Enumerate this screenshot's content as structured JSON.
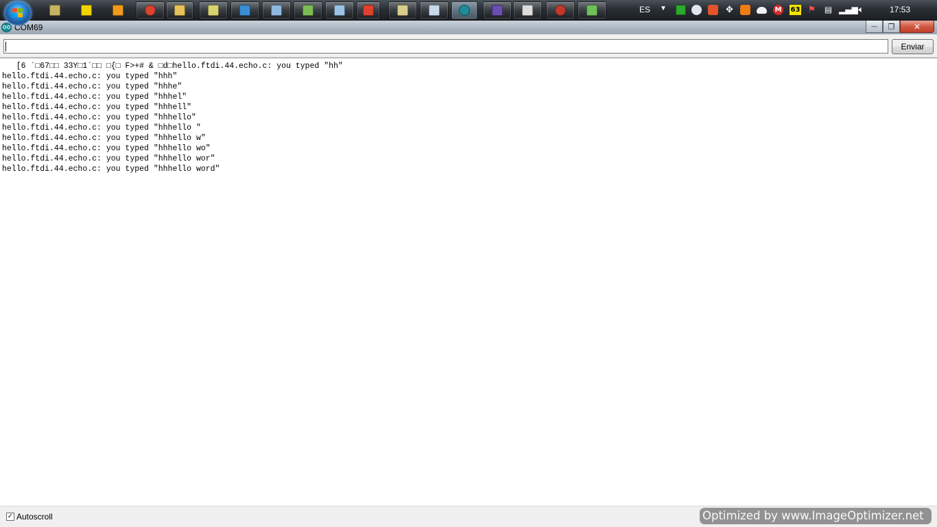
{
  "taskbar": {
    "apps": [
      {
        "name": "media-center-icon",
        "color": "#c8b460"
      },
      {
        "name": "netbeans-like-icon",
        "color": "#f2d200"
      },
      {
        "name": "media-player-icon",
        "color": "#f29a1c"
      },
      {
        "name": "chrome-icon",
        "color": "#d9432f"
      },
      {
        "name": "explorer-folder-icon",
        "color": "#e7c25a"
      },
      {
        "name": "files-icon",
        "color": "#d7d36f"
      },
      {
        "name": "remote-desktop-icon",
        "color": "#3a8fd4"
      },
      {
        "name": "notepad-icon",
        "color": "#8fb9e0"
      },
      {
        "name": "git-icon",
        "color": "#7bbd55"
      },
      {
        "name": "window-icon",
        "color": "#9cc3e6"
      },
      {
        "name": "red-app-icon",
        "color": "#e0412f"
      },
      {
        "name": "editor-icon",
        "color": "#d9cd8a"
      },
      {
        "name": "document-icon",
        "color": "#c9d9ea"
      },
      {
        "name": "arduino-icon",
        "color": "#1c8c96"
      },
      {
        "name": "inkscape-icon",
        "color": "#6a4fb0"
      },
      {
        "name": "inkscape-alt-icon",
        "color": "#dddddd"
      },
      {
        "name": "bug-icon",
        "color": "#c0392b"
      },
      {
        "name": "terminal-icon",
        "color": "#6fbf5a"
      }
    ],
    "language": "ES",
    "badge_count": "63",
    "clock": "17:53"
  },
  "window": {
    "title": "COM69",
    "minimize_glyph": "—",
    "maximize_glyph": "❐",
    "close_glyph": "✕"
  },
  "toolbar": {
    "input_value": "",
    "send_label": "Enviar"
  },
  "serial_output": {
    "lines": [
      "   [6 ´□67□□ 33Y□1´□□ □{□ F>+# & □d□hello.ftdi.44.echo.c: you typed \"hh\"",
      "hello.ftdi.44.echo.c: you typed \"hhh\"",
      "hello.ftdi.44.echo.c: you typed \"hhhe\"",
      "hello.ftdi.44.echo.c: you typed \"hhhel\"",
      "hello.ftdi.44.echo.c: you typed \"hhhell\"",
      "hello.ftdi.44.echo.c: you typed \"hhhello\"",
      "hello.ftdi.44.echo.c: you typed \"hhhello \"",
      "hello.ftdi.44.echo.c: you typed \"hhhello w\"",
      "hello.ftdi.44.echo.c: you typed \"hhhello wo\"",
      "hello.ftdi.44.echo.c: you typed \"hhhello wor\"",
      "hello.ftdi.44.echo.c: you typed \"hhhello word\""
    ]
  },
  "statusbar": {
    "autoscroll_label": "Autoscroll",
    "autoscroll_checked": true,
    "watermark": "Optimized by www.ImageOptimizer.net"
  }
}
